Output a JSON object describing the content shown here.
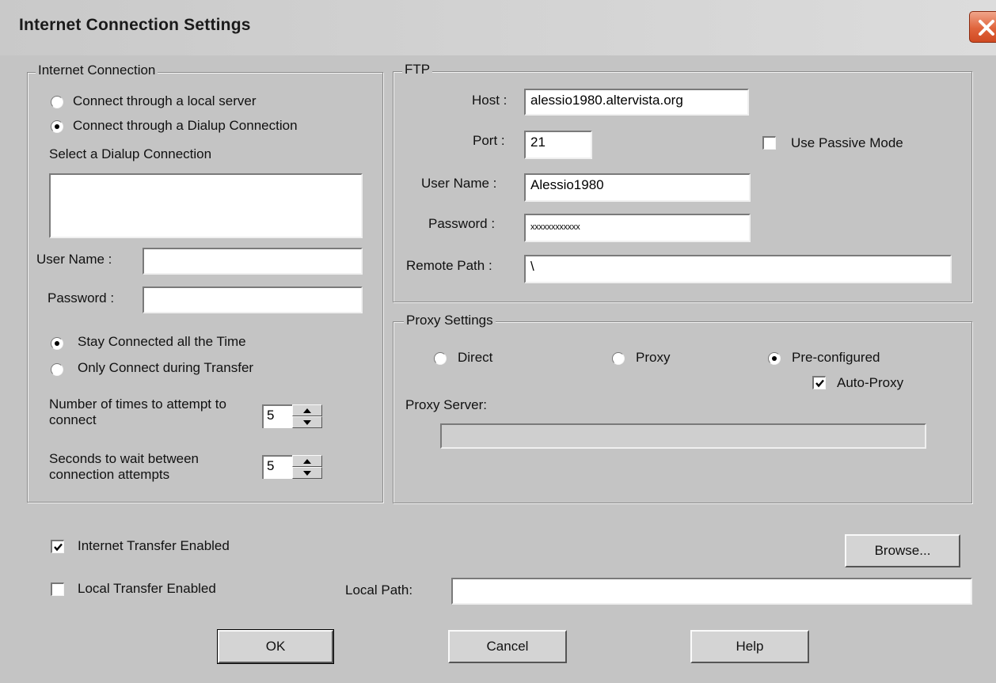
{
  "window": {
    "title": "Internet Connection Settings"
  },
  "internet_connection": {
    "legend": "Internet Connection",
    "radio_local": "Connect through a local server",
    "radio_dialup": "Connect through a Dialup Connection",
    "select_label": "Select a Dialup Connection",
    "username_label": "User Name :",
    "username_value": "",
    "password_label": "Password :",
    "password_value": "",
    "stay_connected": "Stay Connected all the Time",
    "only_connect": "Only Connect during Transfer",
    "attempts_label": "Number of times to attempt to connect",
    "attempts_value": "5",
    "wait_label": "Seconds to wait between connection attempts",
    "wait_value": "5"
  },
  "ftp": {
    "legend": "FTP",
    "host_label": "Host :",
    "host_value": "alessio1980.altervista.org",
    "port_label": "Port :",
    "port_value": "21",
    "passive_label": "Use Passive Mode",
    "username_label": "User Name :",
    "username_value": "Alessio1980",
    "password_label": "Password :",
    "password_value": "xxxxxxxxxxxx",
    "remote_path_label": "Remote Path :",
    "remote_path_value": "\\"
  },
  "proxy": {
    "legend": "Proxy Settings",
    "direct_label": "Direct",
    "proxy_label": "Proxy",
    "preconfigured_label": "Pre-configured",
    "auto_proxy_label": "Auto-Proxy",
    "server_label": "Proxy Server:",
    "server_value": ""
  },
  "bottom": {
    "internet_transfer_label": "Internet Transfer Enabled",
    "local_transfer_label": "Local Transfer Enabled",
    "local_path_label": "Local Path:",
    "local_path_value": "",
    "browse_label": "Browse...",
    "ok_label": "OK",
    "cancel_label": "Cancel",
    "help_label": "Help"
  },
  "state": {
    "connection_mode": "dialup",
    "stay_mode": "stay_connected",
    "proxy_mode": "pre-configured",
    "use_passive_mode": false,
    "auto_proxy": true,
    "internet_transfer_enabled": true,
    "local_transfer_enabled": false
  },
  "icons": {
    "close": "close-icon",
    "spinner_up": "arrow-up-icon",
    "spinner_down": "arrow-down-icon",
    "checkmark": "checkmark-icon"
  },
  "colors": {
    "dialog_background": "#c4c4c4",
    "close_button": "#e0643c"
  }
}
